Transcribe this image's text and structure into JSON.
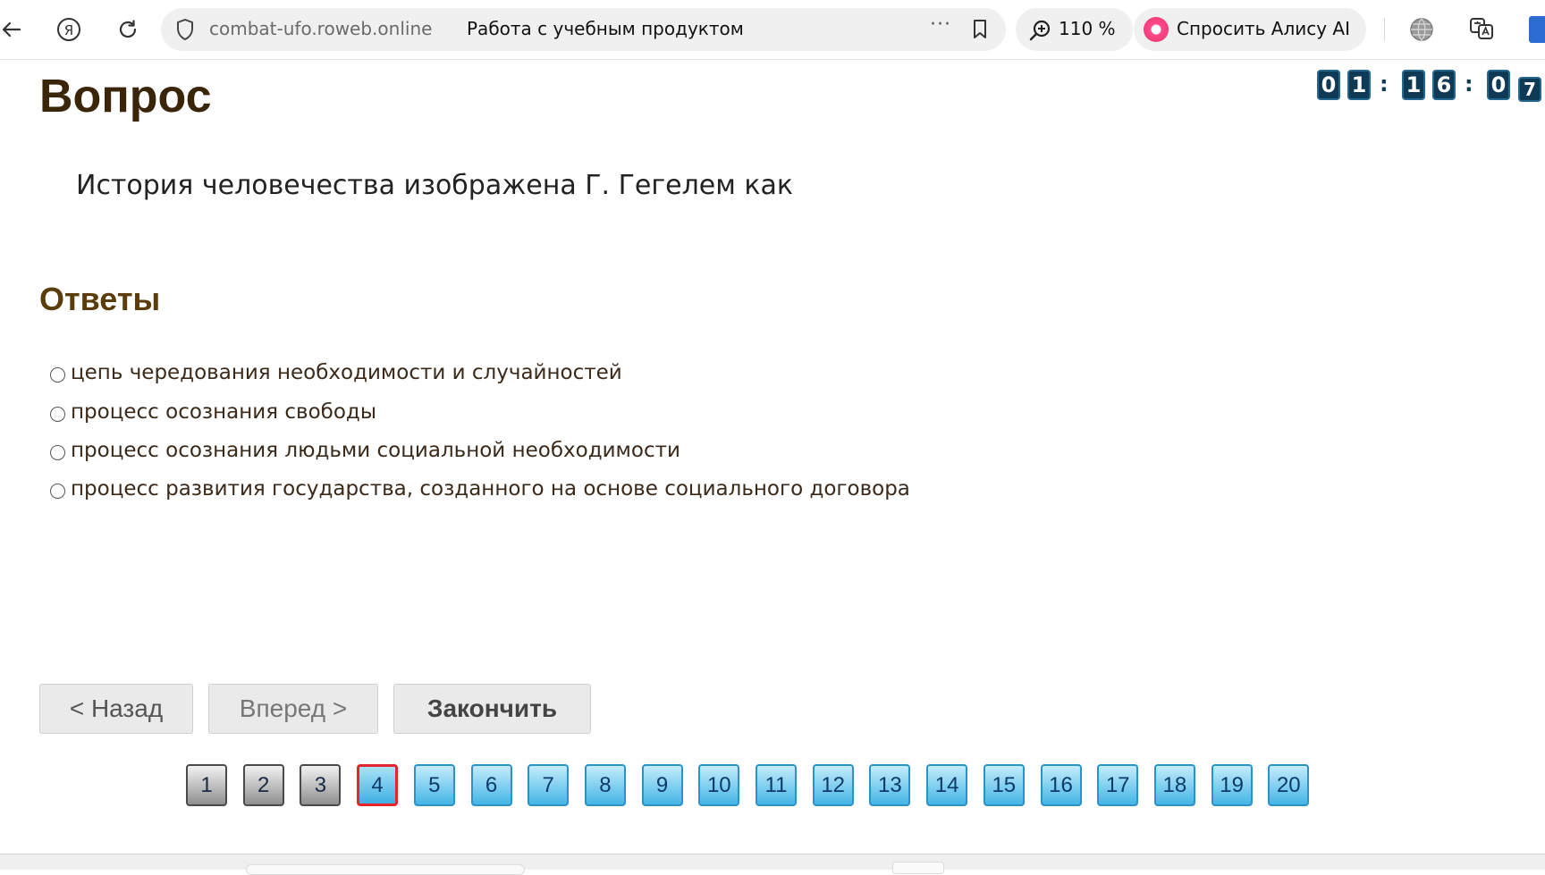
{
  "browser": {
    "domain": "combat-ufo.roweb.online",
    "page_title": "Работа с учебным продуктом",
    "more_icon": "···",
    "zoom": "110 %",
    "alice_label": "Спросить Алису AI",
    "back_icon": "arrow-left",
    "yandex_icon": "yandex",
    "reload_icon": "reload"
  },
  "timer": {
    "hours": [
      "0",
      "1"
    ],
    "minutes": [
      "1",
      "6"
    ],
    "seconds": [
      "0",
      "7"
    ],
    "separator": ":"
  },
  "question": {
    "heading": "Вопрос",
    "text": "История человечества изображена Г. Гегелем как"
  },
  "answers": {
    "heading": "Ответы",
    "options": [
      "цепь чередования необходимости и случайностей",
      "процесс осознания свободы",
      "процесс осознания людьми социальной необходимости",
      "процесс развития государства, созданного на основе социального договора"
    ]
  },
  "buttons": {
    "back": "< Назад",
    "forward": "Вперед >",
    "finish": "Закончить"
  },
  "pagination": {
    "current": 4,
    "pages": [
      {
        "label": "1",
        "state": "visited"
      },
      {
        "label": "2",
        "state": "visited"
      },
      {
        "label": "3",
        "state": "visited"
      },
      {
        "label": "4",
        "state": "current"
      },
      {
        "label": "5",
        "state": "pending"
      },
      {
        "label": "6",
        "state": "pending"
      },
      {
        "label": "7",
        "state": "pending"
      },
      {
        "label": "8",
        "state": "pending"
      },
      {
        "label": "9",
        "state": "pending"
      },
      {
        "label": "10",
        "state": "pending"
      },
      {
        "label": "11",
        "state": "pending"
      },
      {
        "label": "12",
        "state": "pending"
      },
      {
        "label": "13",
        "state": "pending"
      },
      {
        "label": "14",
        "state": "pending"
      },
      {
        "label": "15",
        "state": "pending"
      },
      {
        "label": "16",
        "state": "pending"
      },
      {
        "label": "17",
        "state": "pending"
      },
      {
        "label": "18",
        "state": "pending"
      },
      {
        "label": "19",
        "state": "pending"
      },
      {
        "label": "20",
        "state": "pending"
      }
    ]
  },
  "colors": {
    "heading": "#3a2508",
    "answers_heading": "#5a3d0a",
    "timer_bg": "#0e3a56",
    "page_pending": "#44b5e6",
    "page_current_border": "#e8232b",
    "page_visited": "#8f8f8f"
  }
}
